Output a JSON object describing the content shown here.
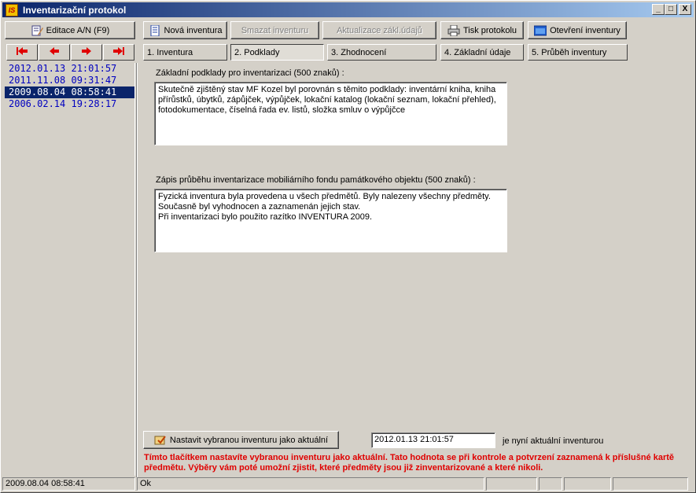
{
  "window": {
    "title": "Inventarizační protokol",
    "app_icon_text": "IS",
    "minimize": "_",
    "maximize": "□",
    "close": "X"
  },
  "toolbar": {
    "edit_label": "Editace A/N (F9)",
    "new_label": "Nová inventura",
    "delete_label": "Smazat inventuru",
    "update_label": "Aktualizace zákl.údajů",
    "print_label": "Tisk protokolu",
    "open_label": "Otevření inventury"
  },
  "tabs": [
    {
      "label": "1. Inventura"
    },
    {
      "label": "2. Podklady"
    },
    {
      "label": "3. Zhodnocení"
    },
    {
      "label": "4. Základní údaje"
    },
    {
      "label": "5. Průběh inventury"
    }
  ],
  "dates": [
    "2012.01.13 21:01:57",
    "2011.11.08 09:31:47",
    "2009.08.04 08:58:41",
    "2006.02.14 19:28:17"
  ],
  "main": {
    "podklady_label": "Základní podklady pro inventarizaci (500 znaků) :",
    "podklady_text": "Skutečně zjištěný stav MF Kozel byl porovnán s těmito podklady: inventární kniha, kniha přírůstků, úbytků, zápůjček, výpůjček, lokační katalog (lokační seznam, lokační přehled), fotodokumentace, číselná řada ev. listů, složka smluv o výpůjčce",
    "prubeh_label": "Zápis průběhu inventarizace mobiliárního fondu památkového objektu (500 znaků) :",
    "prubeh_text": "Fyzická inventura byla provedena u všech předmětů. Byly nalezeny všechny předměty. Současně byl vyhodnocen a zaznamenán jejich stav.\nPři inventarizaci bylo použito razítko INVENTURA 2009."
  },
  "actual": {
    "button_label": "Nastavit vybranou inventuru jako aktuální",
    "value": "2012.01.13 21:01:57",
    "suffix": "je nyní aktuální inventurou",
    "warning": "Tímto tlačítkem nastavíte vybranou inventuru jako aktuální. Tato hodnota se při kontrole a potvrzení zaznamená k příslušné kartě předmětu. Výběry vám poté umožní zjistit, které předměty jsou již zinventarizované a které nikoli."
  },
  "status": {
    "date": "2009.08.04 08:58:41",
    "message": "Ok"
  },
  "colors": {
    "selected_bg": "#0a246a",
    "date_text": "#0000c0",
    "warning": "#e00000"
  }
}
